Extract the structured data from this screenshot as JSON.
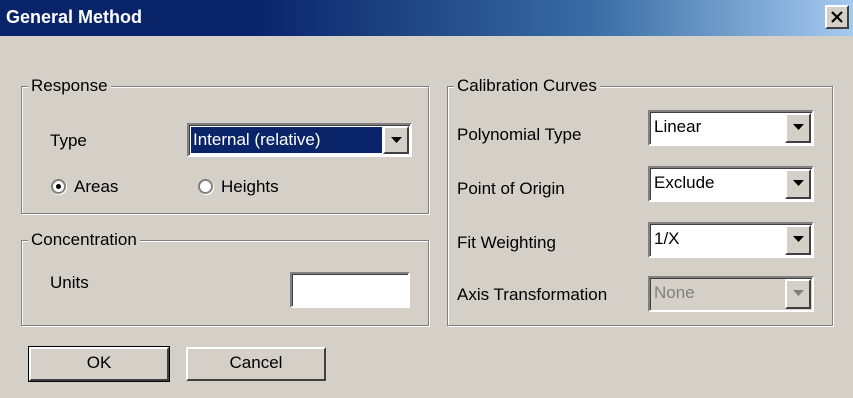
{
  "window": {
    "title": "General Method",
    "close_glyph": "close-icon"
  },
  "response": {
    "legend": "Response",
    "type_label": "Type",
    "type_value": "Internal (relative)",
    "radio_areas": "Areas",
    "radio_heights": "Heights",
    "selected_radio": "Areas"
  },
  "concentration": {
    "legend": "Concentration",
    "units_label": "Units",
    "units_value": ""
  },
  "calibration": {
    "legend": "Calibration Curves",
    "polynomial_label": "Polynomial Type",
    "polynomial_value": "Linear",
    "origin_label": "Point of Origin",
    "origin_value": "Exclude",
    "weighting_label": "Fit Weighting",
    "weighting_value": "1/X",
    "axis_label": "Axis Transformation",
    "axis_value": "None"
  },
  "buttons": {
    "ok": "OK",
    "cancel": "Cancel"
  }
}
